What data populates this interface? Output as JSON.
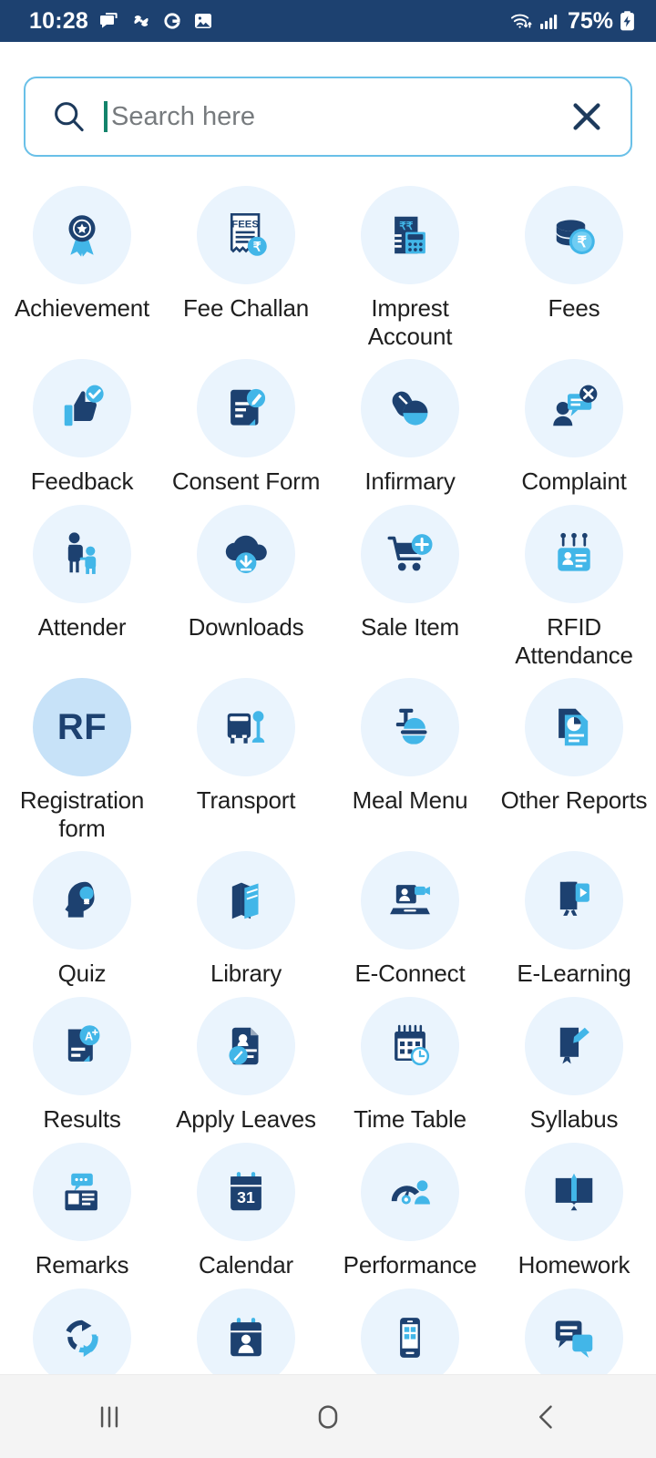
{
  "status_bar": {
    "time": "10:28",
    "battery": "75%",
    "background_color": "#1d4170",
    "left_icons": [
      "chat-bubble-icon",
      "pinwheel-icon",
      "google-g-icon",
      "gallery-image-icon"
    ],
    "right_icons": [
      "wifi-icon",
      "signal-bars-icon",
      "battery-charging-icon"
    ]
  },
  "search": {
    "placeholder": "Search here",
    "value": "",
    "search_icon": "search-icon",
    "clear_icon": "close-x-icon",
    "border_color": "#69c0e8",
    "caret_color": "#13836b"
  },
  "theme": {
    "primary_dark": "#1d4170",
    "primary_light": "#42b6e8",
    "tile_bg": "#eaf4fd",
    "tile_bg_accent": "#c7e2f8",
    "label_color": "#1f1f1f"
  },
  "grid": {
    "columns": 4,
    "rows": [
      {
        "tall": true,
        "tiles": [
          {
            "label": "Achievement",
            "icon": "award-ribbon-icon",
            "accent": false
          },
          {
            "label": "Fee Challan",
            "icon": "fees-receipt-icon",
            "accent": false
          },
          {
            "label": "Imprest Account",
            "icon": "rupee-calculator-icon",
            "accent": false
          },
          {
            "label": "Fees",
            "icon": "rupee-coins-icon",
            "accent": false
          }
        ]
      },
      {
        "tall": false,
        "tiles": [
          {
            "label": "Feedback",
            "icon": "thumbs-up-check-icon",
            "accent": false
          },
          {
            "label": "Consent Form",
            "icon": "document-pencil-icon",
            "accent": false
          },
          {
            "label": "Infirmary",
            "icon": "pills-capsule-icon",
            "accent": false
          },
          {
            "label": "Complaint",
            "icon": "person-chat-x-icon",
            "accent": false
          }
        ]
      },
      {
        "tall": true,
        "tiles": [
          {
            "label": "Attender",
            "icon": "parent-child-icon",
            "accent": false
          },
          {
            "label": "Downloads",
            "icon": "cloud-download-icon",
            "accent": false
          },
          {
            "label": "Sale Item",
            "icon": "cart-plus-icon",
            "accent": false
          },
          {
            "label": "RFID Attendance",
            "icon": "rfid-card-icon",
            "accent": false
          }
        ]
      },
      {
        "tall": true,
        "tiles": [
          {
            "label": "Registration form",
            "icon": "rf-text-icon",
            "accent": true
          },
          {
            "label": "Transport",
            "icon": "bus-stop-icon",
            "accent": false
          },
          {
            "label": "Meal Menu",
            "icon": "meal-tray-icon",
            "accent": false
          },
          {
            "label": "Other Reports",
            "icon": "report-chart-icon",
            "accent": false
          }
        ]
      },
      {
        "tall": false,
        "tiles": [
          {
            "label": "Quiz",
            "icon": "head-bulb-icon",
            "accent": false
          },
          {
            "label": "Library",
            "icon": "books-icon",
            "accent": false
          },
          {
            "label": "E-Connect",
            "icon": "laptop-video-icon",
            "accent": false
          },
          {
            "label": "E-Learning",
            "icon": "book-play-icon",
            "accent": false
          }
        ]
      },
      {
        "tall": false,
        "tiles": [
          {
            "label": "Results",
            "icon": "grade-a-plus-icon",
            "accent": false
          },
          {
            "label": "Apply Leaves",
            "icon": "leave-application-icon",
            "accent": false
          },
          {
            "label": "Time Table",
            "icon": "calendar-clock-icon",
            "accent": false
          },
          {
            "label": "Syllabus",
            "icon": "book-pen-icon",
            "accent": false
          }
        ]
      },
      {
        "tall": false,
        "tiles": [
          {
            "label": "Remarks",
            "icon": "remark-note-icon",
            "accent": false
          },
          {
            "label": "Calendar",
            "icon": "calendar-31-icon",
            "accent": false
          },
          {
            "label": "Performance",
            "icon": "gauge-person-icon",
            "accent": false
          },
          {
            "label": "Homework",
            "icon": "open-book-pen-icon",
            "accent": false
          }
        ]
      },
      {
        "tall": false,
        "partial": true,
        "tiles": [
          {
            "label": "",
            "icon": "sync-refresh-icon",
            "accent": false
          },
          {
            "label": "",
            "icon": "attendance-calendar-icon",
            "accent": false
          },
          {
            "label": "",
            "icon": "mobile-app-icon",
            "accent": false
          },
          {
            "label": "",
            "icon": "chat-messages-icon",
            "accent": false
          }
        ]
      }
    ]
  },
  "nav_bar": {
    "background_color": "#f4f4f4",
    "buttons": [
      {
        "name": "recents-button",
        "icon": "recents-bars-icon"
      },
      {
        "name": "home-button",
        "icon": "home-circle-icon"
      },
      {
        "name": "back-button",
        "icon": "back-chevron-icon"
      }
    ]
  }
}
